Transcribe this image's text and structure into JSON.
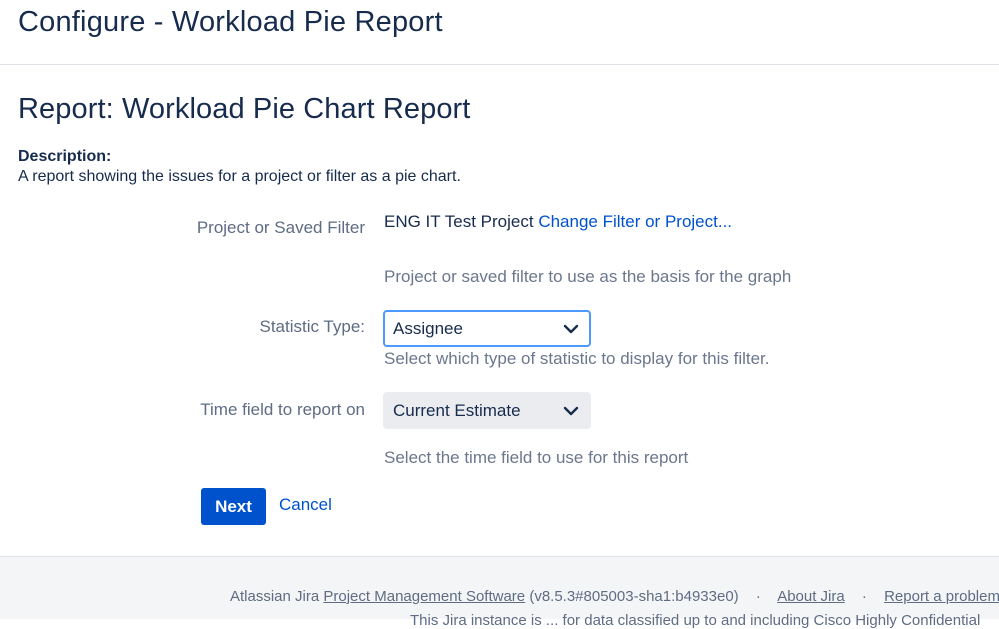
{
  "header": {
    "title": "Configure - Workload Pie Report"
  },
  "report": {
    "title": "Report: Workload Pie Chart Report",
    "description_label": "Description:",
    "description_text": "A report showing the issues for a project or filter as a pie chart."
  },
  "form": {
    "project": {
      "label": "Project or Saved Filter",
      "value": "ENG IT Test Project",
      "change_link": "Change Filter or Project...",
      "help": "Project or saved filter to use as the basis for the graph"
    },
    "statistic": {
      "label": "Statistic Type:",
      "selected": "Assignee",
      "help": "Select which type of statistic to display for this filter."
    },
    "time_field": {
      "label": "Time field to report on",
      "selected": "Current Estimate",
      "help": "Select the time field to use for this report"
    },
    "next_label": "Next",
    "cancel_label": "Cancel"
  },
  "footer": {
    "prefix": "Atlassian Jira",
    "product_link": "Project Management Software",
    "version": "(v8.5.3#805003-sha1:b4933e0)",
    "about_link": "About Jira",
    "report_link": "Report a problem",
    "separator": "·",
    "line2": "This Jira instance is ... for data classified up to and including Cisco Highly Confidential"
  },
  "colors": {
    "primary": "#0052cc",
    "text": "#172b4d",
    "muted": "#6b778c",
    "focus": "#4c9aff"
  }
}
